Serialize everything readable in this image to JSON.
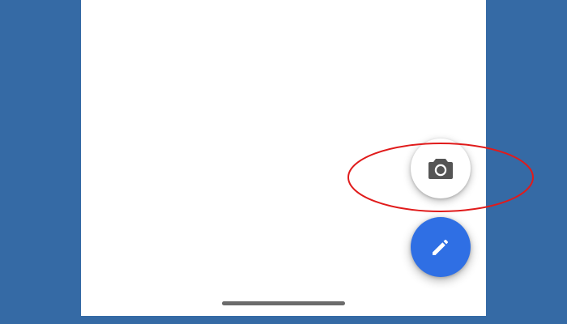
{
  "colors": {
    "background": "#356aa5",
    "screen": "#ffffff",
    "fab_primary": "#2f6fe4",
    "camera_icon": "#555555",
    "compose_icon": "#ffffff",
    "highlight": "#e01b1b",
    "home_indicator": "#6b6b6b"
  },
  "icons": {
    "camera": "camera-icon",
    "compose": "pencil-icon"
  },
  "annotation": {
    "shape": "ellipse",
    "target": "camera-fab-button"
  }
}
